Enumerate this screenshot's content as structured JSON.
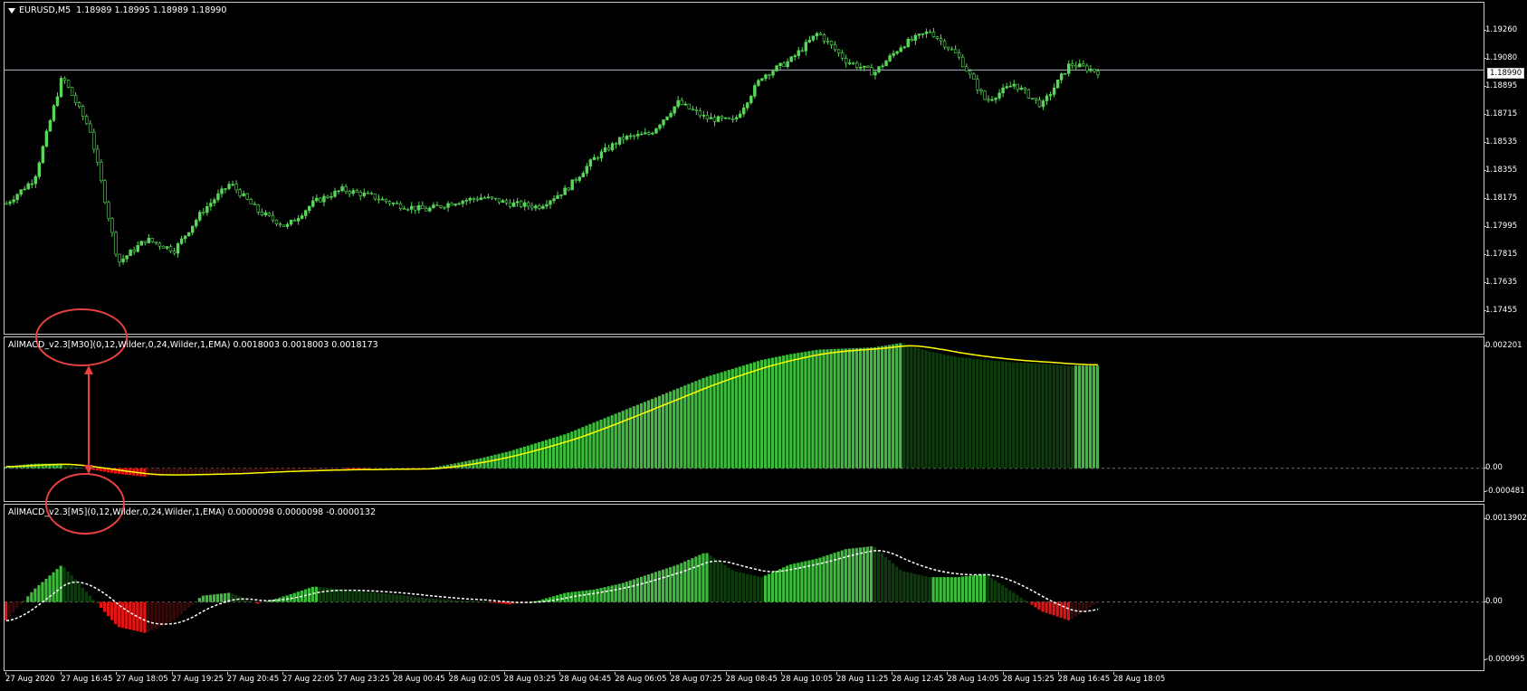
{
  "colors": {
    "background": "#000000",
    "border": "#c8c8c8",
    "candle": "#58d858",
    "macd_pos": "#3cbb3c",
    "macd_pos_dark": "#0e3a0e",
    "macd_neg": "#e31414",
    "macd_neg_dark": "#3a0808",
    "signal_yellow": "#ffff00",
    "signal_white": "#ffffff",
    "annotation": "#e64040",
    "price_line": "#b0b8c8"
  },
  "main_panel": {
    "title": "EURUSD,M5",
    "ohlc": "1.18989 1.18995 1.18989 1.18990",
    "current_price": "1.18990",
    "axis_labels": [
      "1.19260",
      "1.19080",
      "1.18895",
      "1.18715",
      "1.18535",
      "1.18355",
      "1.18175",
      "1.17995",
      "1.17815",
      "1.17635",
      "1.17455"
    ]
  },
  "indicator_m30": {
    "title": "AllMACD_v2.3[M30](0,12,Wilder,0,24,Wilder,1,EMA) 0.0018003 0.0018003 0.0018173",
    "axis_labels": [
      "0.002201",
      "0.00",
      "-0.000481"
    ]
  },
  "indicator_m5": {
    "title": "AllMACD_v2.3[M5](0,12,Wilder,0,24,Wilder,1,EMA) 0.0000098 0.0000098 -0.0000132",
    "axis_labels": [
      "0.0013902",
      "0.00",
      "-0.000995"
    ]
  },
  "time_axis": [
    "27 Aug 2020",
    "27 Aug 16:45",
    "27 Aug 18:05",
    "27 Aug 19:25",
    "27 Aug 20:45",
    "27 Aug 22:05",
    "27 Aug 23:25",
    "28 Aug 00:45",
    "28 Aug 02:05",
    "28 Aug 03:25",
    "28 Aug 04:45",
    "28 Aug 06:05",
    "28 Aug 07:25",
    "28 Aug 08:45",
    "28 Aug 10:05",
    "28 Aug 11:25",
    "28 Aug 12:45",
    "28 Aug 14:05",
    "28 Aug 15:25",
    "28 Aug 16:45",
    "28 Aug 18:05"
  ],
  "chart_data": [
    {
      "type": "candlestick",
      "series": [
        {
          "name": "EURUSD,M5",
          "values": [
            1.1813,
            1.1829,
            1.1895,
            1.186,
            1.1775,
            1.179,
            1.1783,
            1.1808,
            1.1826,
            1.1808,
            1.1798,
            1.1814,
            1.1822,
            1.1818,
            1.1812,
            1.1809,
            1.1814,
            1.1817,
            1.1813,
            1.1811,
            1.1822,
            1.1842,
            1.1855,
            1.1858,
            1.1878,
            1.1868,
            1.1866,
            1.1895,
            1.1905,
            1.1923,
            1.1905,
            1.1897,
            1.1915,
            1.1924,
            1.1908,
            1.1879,
            1.189,
            1.1876,
            1.1903,
            1.1898
          ]
        }
      ],
      "ylim": [
        1.17455,
        1.1926
      ]
    },
    {
      "type": "bar",
      "series": [
        {
          "name": "AllMACD M30",
          "values": [
            3e-05,
            8e-05,
            8e-05,
            -2e-05,
            -0.0001,
            -0.00015,
            -0.00012,
            -0.0001,
            -9e-05,
            -6e-05,
            -4e-05,
            -3e-05,
            -2e-05,
            -2e-05,
            -1e-05,
            -1e-05,
            8e-05,
            0.00018,
            0.0003,
            0.00045,
            0.0006,
            0.0008,
            0.001,
            0.0012,
            0.0014,
            0.0016,
            0.00175,
            0.0019,
            0.002,
            0.00208,
            0.0021,
            0.00212,
            0.0022,
            0.00205,
            0.00195,
            0.0019,
            0.00186,
            0.00184,
            0.0018,
            0.0018
          ]
        }
      ],
      "ylim": [
        -0.000481,
        0.002201
      ]
    },
    {
      "type": "bar",
      "series": [
        {
          "name": "AllMACD M5",
          "values": [
            -0.0003,
            0.0002,
            0.0006,
            0.0001,
            -0.0004,
            -0.0005,
            -0.0003,
            0.0001,
            0.00015,
            -3e-05,
            0.0001,
            0.00025,
            0.0002,
            0.00016,
            0.00012,
            6e-05,
            3e-05,
            1e-05,
            -4e-05,
            2e-05,
            0.00015,
            0.0002,
            0.0003,
            0.00045,
            0.0006,
            0.0008,
            0.0005,
            0.0004,
            0.0006,
            0.0007,
            0.00085,
            0.0009,
            0.0005,
            0.0004,
            0.0004,
            0.00045,
            0.00015,
            -0.00015,
            -0.0003,
            -1e-05
          ]
        }
      ],
      "ylim": [
        -0.000995,
        0.0013902
      ]
    }
  ]
}
